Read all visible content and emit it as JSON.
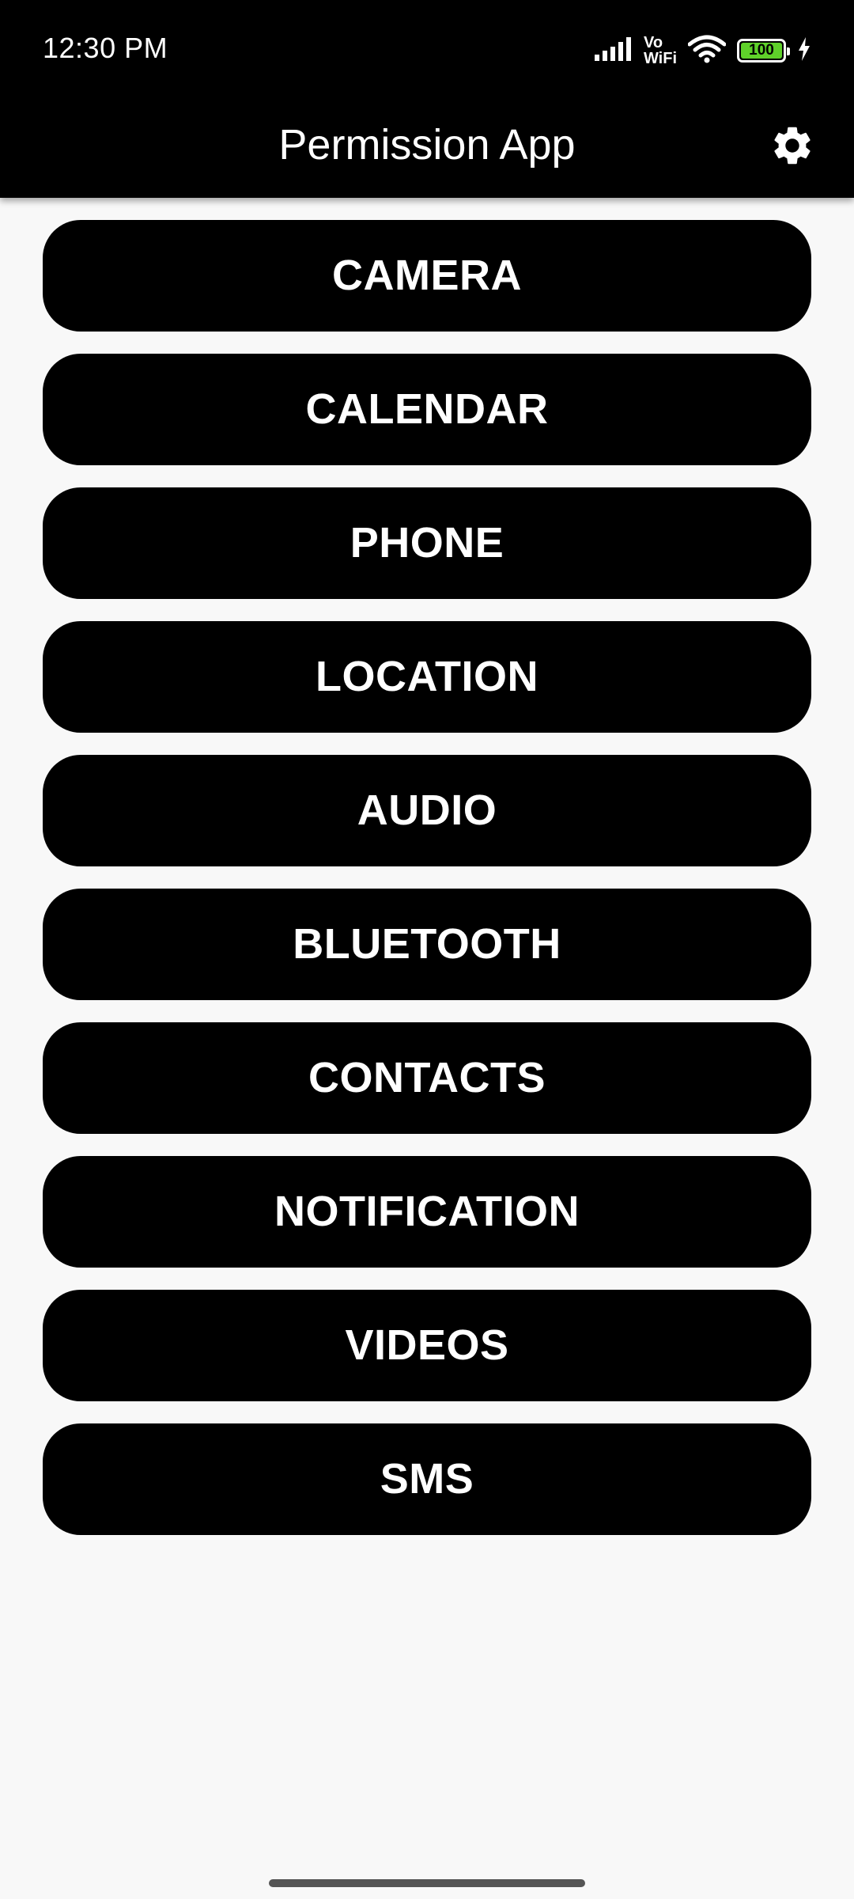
{
  "status_bar": {
    "time": "12:30 PM",
    "vowifi_top": "Vo",
    "vowifi_bottom": "WiFi",
    "battery_level": "100",
    "icons": [
      "signal-icon",
      "vowifi-icon",
      "wifi-icon",
      "battery-icon",
      "charging-icon"
    ]
  },
  "toolbar": {
    "title": "Permission App",
    "settings_icon": "gear-icon",
    "background": "#000000"
  },
  "permissions": [
    {
      "label": "CAMERA"
    },
    {
      "label": "CALENDAR"
    },
    {
      "label": "PHONE"
    },
    {
      "label": "LOCATION"
    },
    {
      "label": "AUDIO"
    },
    {
      "label": "BLUETOOTH"
    },
    {
      "label": "CONTACTS"
    },
    {
      "label": "NOTIFICATION"
    },
    {
      "label": "VIDEOS"
    },
    {
      "label": "SMS"
    }
  ],
  "colors": {
    "button_background": "#000000",
    "button_text": "#ffffff",
    "page_background": "#f8f8f8",
    "battery_fill": "#5fd12a"
  }
}
